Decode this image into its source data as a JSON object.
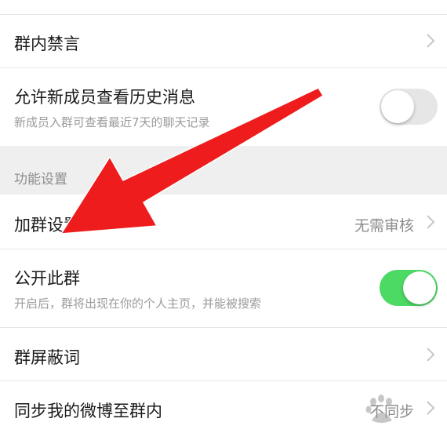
{
  "settings": {
    "mute_row": {
      "title": "群内禁言"
    },
    "history_row": {
      "title": "允许新成员查看历史消息",
      "subtitle": "新成员入群可查看最近7天的聊天记录",
      "toggle_state": "off"
    },
    "section_header": "功能设置",
    "join_row": {
      "title": "加群设置",
      "value": "无需审核"
    },
    "public_row": {
      "title": "公开此群",
      "subtitle": "开启后，群将出现在你的个人主页，并能被搜索",
      "toggle_state": "on"
    },
    "block_words_row": {
      "title": "群屏蔽词"
    },
    "weibo_row": {
      "title": "同步我的微博至群内",
      "value": "不同步"
    }
  },
  "colors": {
    "toggle_on": "#4cd964",
    "toggle_off": "#e6e6e6",
    "annotation_arrow": "#ee1c1c",
    "section_bg": "#efefef"
  },
  "icons": [
    "chevron-right-icon",
    "toggle-switch",
    "red-annotation-arrow",
    "baidu-watermark"
  ]
}
